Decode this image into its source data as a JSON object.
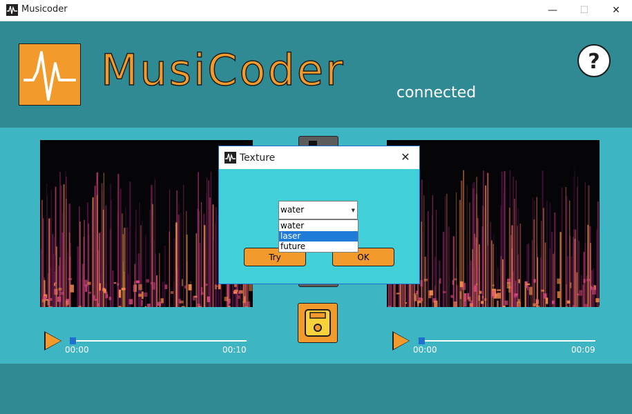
{
  "window": {
    "title": "Musicoder",
    "controls": {
      "minimize": "—",
      "maximize": "☐",
      "close": "✕"
    }
  },
  "header": {
    "brand": "MusiCoder",
    "status": "connected",
    "help_symbol": "?"
  },
  "players": [
    {
      "time_start": "00:00",
      "time_end": "00:10",
      "progress": 0.0
    },
    {
      "time_start": "00:00",
      "time_end": "00:09",
      "progress": 0.0
    }
  ],
  "dialog": {
    "title": "Texture",
    "close": "✕",
    "select_value": "water",
    "options": [
      "water",
      "laser",
      "future"
    ],
    "highlighted_option": "laser",
    "try_label": "Try",
    "ok_label": "OK"
  },
  "colors": {
    "accent": "#f39a2c",
    "header_bg": "#2f8a94",
    "panel_bg": "#3eb5c2",
    "dialog_bg": "#41d0da",
    "selection": "#1f7bd8"
  },
  "icons": [
    "app-waveform-icon",
    "help-icon",
    "play-icon",
    "save-floppy-icon",
    "close-icon",
    "dropdown-arrow-icon"
  ]
}
